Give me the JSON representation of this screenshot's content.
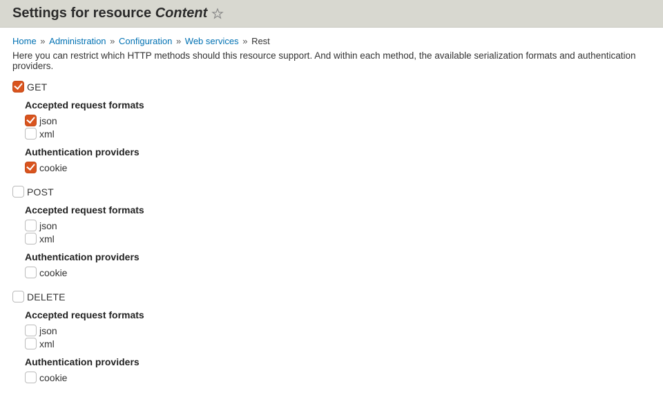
{
  "header": {
    "title_prefix": "Settings for resource ",
    "title_resource": "Content"
  },
  "breadcrumb": {
    "items": [
      {
        "label": "Home",
        "link": true
      },
      {
        "label": "Administration",
        "link": true
      },
      {
        "label": "Configuration",
        "link": true
      },
      {
        "label": "Web services",
        "link": true
      },
      {
        "label": "Rest",
        "link": false
      }
    ],
    "separator": "»"
  },
  "intro_text": "Here you can restrict which HTTP methods should this resource support. And within each method, the available serialization formats and authentication providers.",
  "section_labels": {
    "formats": "Accepted request formats",
    "auth": "Authentication providers"
  },
  "methods": [
    {
      "name": "GET",
      "enabled": true,
      "formats": [
        {
          "label": "json",
          "checked": true
        },
        {
          "label": "xml",
          "checked": false
        }
      ],
      "auth": [
        {
          "label": "cookie",
          "checked": true
        }
      ]
    },
    {
      "name": "POST",
      "enabled": false,
      "formats": [
        {
          "label": "json",
          "checked": false
        },
        {
          "label": "xml",
          "checked": false
        }
      ],
      "auth": [
        {
          "label": "cookie",
          "checked": false
        }
      ]
    },
    {
      "name": "DELETE",
      "enabled": false,
      "formats": [
        {
          "label": "json",
          "checked": false
        },
        {
          "label": "xml",
          "checked": false
        }
      ],
      "auth": [
        {
          "label": "cookie",
          "checked": false
        }
      ]
    }
  ]
}
